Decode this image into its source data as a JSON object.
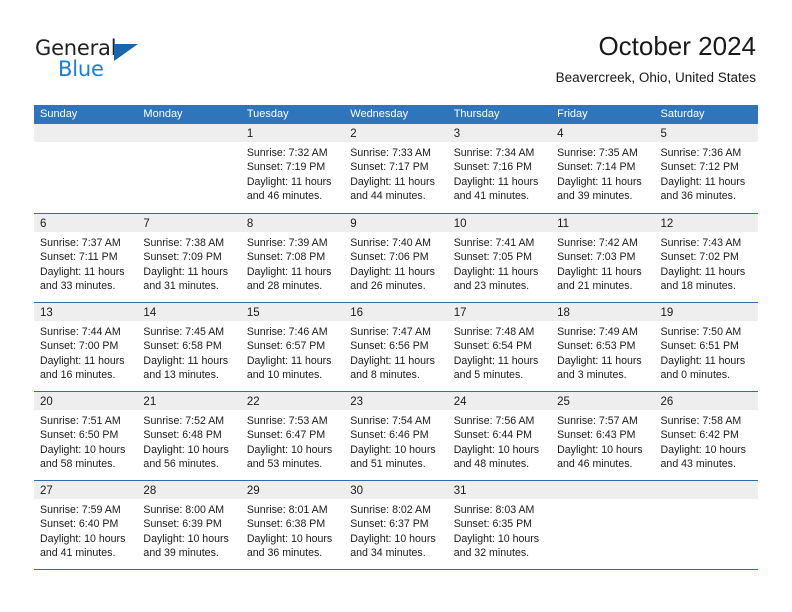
{
  "logo": {
    "word_one": "General",
    "word_two": "Blue",
    "triangle_color": "#1866ab",
    "blue_color": "#1a7fd4"
  },
  "header": {
    "title": "October 2024",
    "subtitle": "Beavercreek, Ohio, United States",
    "header_bg": "#3075bc",
    "band_bg": "#eeeeee",
    "rule_color": "#2b6daf"
  },
  "weekdays": [
    "Sunday",
    "Monday",
    "Tuesday",
    "Wednesday",
    "Thursday",
    "Friday",
    "Saturday"
  ],
  "weeks": [
    [
      {
        "day": "",
        "lines": []
      },
      {
        "day": "",
        "lines": []
      },
      {
        "day": "1",
        "lines": [
          "Sunrise: 7:32 AM",
          "Sunset: 7:19 PM",
          "Daylight: 11 hours",
          "and 46 minutes."
        ]
      },
      {
        "day": "2",
        "lines": [
          "Sunrise: 7:33 AM",
          "Sunset: 7:17 PM",
          "Daylight: 11 hours",
          "and 44 minutes."
        ]
      },
      {
        "day": "3",
        "lines": [
          "Sunrise: 7:34 AM",
          "Sunset: 7:16 PM",
          "Daylight: 11 hours",
          "and 41 minutes."
        ]
      },
      {
        "day": "4",
        "lines": [
          "Sunrise: 7:35 AM",
          "Sunset: 7:14 PM",
          "Daylight: 11 hours",
          "and 39 minutes."
        ]
      },
      {
        "day": "5",
        "lines": [
          "Sunrise: 7:36 AM",
          "Sunset: 7:12 PM",
          "Daylight: 11 hours",
          "and 36 minutes."
        ]
      }
    ],
    [
      {
        "day": "6",
        "lines": [
          "Sunrise: 7:37 AM",
          "Sunset: 7:11 PM",
          "Daylight: 11 hours",
          "and 33 minutes."
        ]
      },
      {
        "day": "7",
        "lines": [
          "Sunrise: 7:38 AM",
          "Sunset: 7:09 PM",
          "Daylight: 11 hours",
          "and 31 minutes."
        ]
      },
      {
        "day": "8",
        "lines": [
          "Sunrise: 7:39 AM",
          "Sunset: 7:08 PM",
          "Daylight: 11 hours",
          "and 28 minutes."
        ]
      },
      {
        "day": "9",
        "lines": [
          "Sunrise: 7:40 AM",
          "Sunset: 7:06 PM",
          "Daylight: 11 hours",
          "and 26 minutes."
        ]
      },
      {
        "day": "10",
        "lines": [
          "Sunrise: 7:41 AM",
          "Sunset: 7:05 PM",
          "Daylight: 11 hours",
          "and 23 minutes."
        ]
      },
      {
        "day": "11",
        "lines": [
          "Sunrise: 7:42 AM",
          "Sunset: 7:03 PM",
          "Daylight: 11 hours",
          "and 21 minutes."
        ]
      },
      {
        "day": "12",
        "lines": [
          "Sunrise: 7:43 AM",
          "Sunset: 7:02 PM",
          "Daylight: 11 hours",
          "and 18 minutes."
        ]
      }
    ],
    [
      {
        "day": "13",
        "lines": [
          "Sunrise: 7:44 AM",
          "Sunset: 7:00 PM",
          "Daylight: 11 hours",
          "and 16 minutes."
        ]
      },
      {
        "day": "14",
        "lines": [
          "Sunrise: 7:45 AM",
          "Sunset: 6:58 PM",
          "Daylight: 11 hours",
          "and 13 minutes."
        ]
      },
      {
        "day": "15",
        "lines": [
          "Sunrise: 7:46 AM",
          "Sunset: 6:57 PM",
          "Daylight: 11 hours",
          "and 10 minutes."
        ]
      },
      {
        "day": "16",
        "lines": [
          "Sunrise: 7:47 AM",
          "Sunset: 6:56 PM",
          "Daylight: 11 hours",
          "and 8 minutes."
        ]
      },
      {
        "day": "17",
        "lines": [
          "Sunrise: 7:48 AM",
          "Sunset: 6:54 PM",
          "Daylight: 11 hours",
          "and 5 minutes."
        ]
      },
      {
        "day": "18",
        "lines": [
          "Sunrise: 7:49 AM",
          "Sunset: 6:53 PM",
          "Daylight: 11 hours",
          "and 3 minutes."
        ]
      },
      {
        "day": "19",
        "lines": [
          "Sunrise: 7:50 AM",
          "Sunset: 6:51 PM",
          "Daylight: 11 hours",
          "and 0 minutes."
        ]
      }
    ],
    [
      {
        "day": "20",
        "lines": [
          "Sunrise: 7:51 AM",
          "Sunset: 6:50 PM",
          "Daylight: 10 hours",
          "and 58 minutes."
        ]
      },
      {
        "day": "21",
        "lines": [
          "Sunrise: 7:52 AM",
          "Sunset: 6:48 PM",
          "Daylight: 10 hours",
          "and 56 minutes."
        ]
      },
      {
        "day": "22",
        "lines": [
          "Sunrise: 7:53 AM",
          "Sunset: 6:47 PM",
          "Daylight: 10 hours",
          "and 53 minutes."
        ]
      },
      {
        "day": "23",
        "lines": [
          "Sunrise: 7:54 AM",
          "Sunset: 6:46 PM",
          "Daylight: 10 hours",
          "and 51 minutes."
        ]
      },
      {
        "day": "24",
        "lines": [
          "Sunrise: 7:56 AM",
          "Sunset: 6:44 PM",
          "Daylight: 10 hours",
          "and 48 minutes."
        ]
      },
      {
        "day": "25",
        "lines": [
          "Sunrise: 7:57 AM",
          "Sunset: 6:43 PM",
          "Daylight: 10 hours",
          "and 46 minutes."
        ]
      },
      {
        "day": "26",
        "lines": [
          "Sunrise: 7:58 AM",
          "Sunset: 6:42 PM",
          "Daylight: 10 hours",
          "and 43 minutes."
        ]
      }
    ],
    [
      {
        "day": "27",
        "lines": [
          "Sunrise: 7:59 AM",
          "Sunset: 6:40 PM",
          "Daylight: 10 hours",
          "and 41 minutes."
        ]
      },
      {
        "day": "28",
        "lines": [
          "Sunrise: 8:00 AM",
          "Sunset: 6:39 PM",
          "Daylight: 10 hours",
          "and 39 minutes."
        ]
      },
      {
        "day": "29",
        "lines": [
          "Sunrise: 8:01 AM",
          "Sunset: 6:38 PM",
          "Daylight: 10 hours",
          "and 36 minutes."
        ]
      },
      {
        "day": "30",
        "lines": [
          "Sunrise: 8:02 AM",
          "Sunset: 6:37 PM",
          "Daylight: 10 hours",
          "and 34 minutes."
        ]
      },
      {
        "day": "31",
        "lines": [
          "Sunrise: 8:03 AM",
          "Sunset: 6:35 PM",
          "Daylight: 10 hours",
          "and 32 minutes."
        ]
      },
      {
        "day": "",
        "lines": []
      },
      {
        "day": "",
        "lines": []
      }
    ]
  ]
}
